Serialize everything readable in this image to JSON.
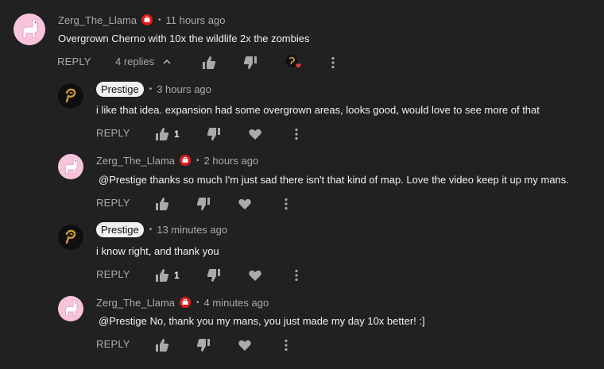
{
  "colors": {
    "background": "#212121",
    "text": "#f1f1f1",
    "muted": "#aaaaaa",
    "badge_red": "#e21b1b",
    "heart_red": "#e53935"
  },
  "top_comment": {
    "author": "Zerg_The_Llama",
    "time": "11 hours ago",
    "text": "Overgrown Cherno with 10x the wildlife 2x the zombies",
    "reply_label": "REPLY",
    "replies_label": "4 replies",
    "icons": [
      "thumbs-up-icon",
      "thumbs-down-icon",
      "creator-heart-icon",
      "more-vert-icon",
      "chevron-up-icon"
    ]
  },
  "replies": [
    {
      "author": "Prestige",
      "time": "3 hours ago",
      "text": "i like that idea. expansion had some overgrown areas, looks good, would love to see more of that",
      "reply_label": "REPLY",
      "likes": "1"
    },
    {
      "author": "Zerg_The_Llama",
      "time": "2 hours ago",
      "text": "@Prestige  thanks so much I'm just sad there isn't that kind of map. Love the video keep it up my mans.",
      "reply_label": "REPLY",
      "likes": ""
    },
    {
      "author": "Prestige",
      "time": "13 minutes ago",
      "text": "i know right, and thank you",
      "reply_label": "REPLY",
      "likes": "1"
    },
    {
      "author": "Zerg_The_Llama",
      "time": "4 minutes ago",
      "text": "@Prestige  No, thank you my mans, you just made my day 10x better! :]",
      "reply_label": "REPLY",
      "likes": ""
    }
  ],
  "separator": "•"
}
